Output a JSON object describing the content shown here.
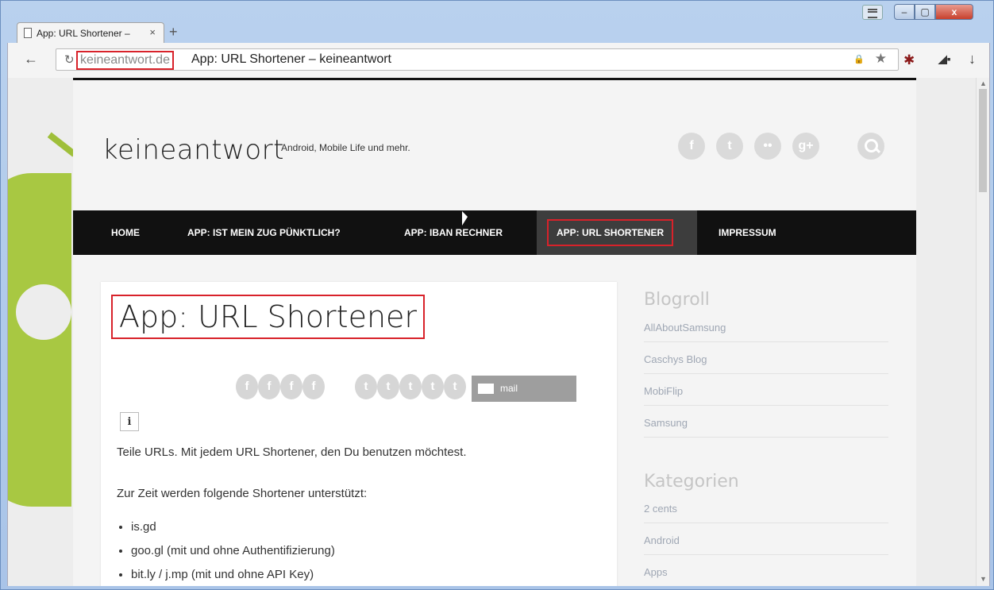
{
  "browser": {
    "tab_title": "App: URL Shortener – ",
    "tab_close": "×",
    "new_tab": "+",
    "back": "←",
    "reload": "↻",
    "url_domain": "keineantwort.de",
    "url_page_title": "App: URL Shortener – keineantwort",
    "lock": "🔒",
    "star": "★",
    "window_min": "–",
    "window_max": "▢",
    "window_close": "x",
    "download": "↓"
  },
  "site": {
    "logo": "keineantwort",
    "tagline": "Android, Mobile Life und mehr.",
    "social": [
      {
        "glyph": "f",
        "icon": "facebook-icon"
      },
      {
        "glyph": "t",
        "icon": "twitter-icon"
      },
      {
        "glyph": "••",
        "icon": "flickr-icon"
      },
      {
        "glyph": "g+",
        "icon": "googleplus-icon"
      }
    ],
    "nav": [
      {
        "label": "HOME"
      },
      {
        "label": "APP: IST MEIN ZUG PÜNKTLICH?"
      },
      {
        "label": "APP: IBAN RECHNER"
      },
      {
        "label": "APP: URL SHORTENER",
        "active": true
      },
      {
        "label": "IMPRESSUM"
      }
    ]
  },
  "post": {
    "title": "App: URL Shortener",
    "share_facebook": "f",
    "share_twitter": "t",
    "mail_label": "mail",
    "info": "i",
    "intro": "Teile URLs. Mit jedem URL Shortener, den Du benutzen möchtest.",
    "supported_heading": "Zur Zeit werden folgende Shortener unterstützt:",
    "shorteners": [
      "is.gd",
      "goo.gl (mit und ohne Authentifizierung)",
      "bit.ly / j.mp (mit und ohne API Key)"
    ]
  },
  "sidebar": {
    "blogroll_heading": "Blogroll",
    "blogroll": [
      "AllAboutSamsung",
      "Caschys Blog",
      "MobiFlip",
      "Samsung"
    ],
    "categories_heading": "Kategorien",
    "categories": [
      "2 cents",
      "Android",
      "Apps"
    ]
  },
  "colors": {
    "highlight": "#d8222a",
    "nav_bg": "#111111",
    "nav_active": "#3d3d3d",
    "android_green": "#a4c639"
  }
}
